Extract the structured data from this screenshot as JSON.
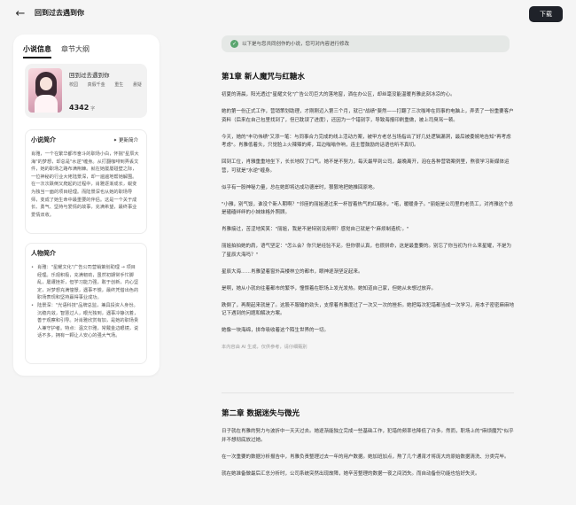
{
  "header": {
    "title": "回到过去遇到你"
  },
  "download_label": "下载",
  "tabs": [
    "小说信息",
    "章节大纲"
  ],
  "novel": {
    "name": "回到过去遇到你",
    "tags": [
      "校园",
      "真假千金",
      "重生",
      "悬疑"
    ],
    "word_count": "4342",
    "word_unit": "字"
  },
  "synopsis": {
    "title": "小说简介",
    "update_label": "更新简介",
    "text": "肖雅，一个在繁华都市奋斗的职场小白，怀揣\"星辰大海\"的梦想，却总是\"水逆\"缠身。从打翻咖啡到弄丢文件，她的职场之路布满荆棘。就在她屡屡碰壁之际，一位神秘的行业大佬陆景深，却一遍遍地帮她解围。在一次次跌倒又爬起的过程中，肖雅逐渐成长，蜕变为独当一面的项目经理。而陆景深也从她的职场导师，变成了她生命中最重要的伴侣。这是一个关于成长、勇气、坚持与爱情的故事，充满希望，最终事业爱情双收。"
  },
  "characters": {
    "title": "人物简介",
    "items": [
      "肖雅：\"星耀文化\"广告公司营销策划助理 → 项目经理。乐观积极，充满韧劲，虽然初期常手忙脚乱，屡遭挫折，但学习能力强，敢于创新，内心坚定，对梦想充满憧憬，遇事不慌，最终凭借出色的职场表现和坚持赢得事业成功。",
      "陆景深：\"光语科技\"品牌总监，兼具投资人身份。沉稳内敛，智慧过人，眼光独到，遇事冷静沉着，善于观察和引导。对肖雅欣赏有加，是她的职场贵人兼守护者。特点：温文尔雅，常戴金边眼镜，说话不多，拥有一颗让人安心的强大气场。"
    ]
  },
  "notice": "以下是与您共同创作的小说，您可对内容进行修改",
  "chapters": [
    {
      "title": "第1章 新人魔咒与红糖水",
      "paragraphs": [
        "初夏的清晨，阳光透过\"星耀文化\"广告公司巨大的落地窗，洒在办公区，却丝毫没能温暖肖雅此刻冰凉的心。",
        "她的第一份正式工作，营销策划助理，才刚刚迈入第三个月，就已\"战绩\"斐然——打翻了三次咖啡在同事的电脑上，弄丢了一份重要客户资料（后来在自己包里找到了，但已耽误了进度），还因为一个错别字，导致海报印刷重做，被上司臭骂一顿。",
        "今天，她的\"丰功伟绩\"又添一笔：与同事合力完成的线上活动方案，被甲方老总当场指出了好几处逻辑漏洞，最后被委婉地告知\"再考虑考虑\"。肖雅低着头，只觉脸上火辣辣的疼，耳边嗡嗡作响，连主管鼓励的话语也听不真切。",
        "回到工位，肖雅重重地坐下，长长地叹了口气。她不是不努力，每天最早到公司，最晚离开，泡在各种营销案例里，熬夜学习新媒体运营，可就是\"水逆\"缠身。",
        "似乎有一股神秘力量，总在她即将达成功德岸时，狠狠地把她推回原地。",
        "\"小雅，别气馁，谁没个新人期啊？\"邻座的丽姐递过来一杯冒着热气的红糖水，\"喏，暖暖身子。\"丽姐是公司里的老员工，对肖雅这个总是磕磕绊绊的小妹妹格外照顾。",
        "肖雅接过，苦涩地笑笑：\"丽姐，我是不是特别没用啊？感觉自己就是个'麻烦制造机'。\"",
        "丽姐拍拍她的肩，语气坚定：\"怎么会？你只是经验不足。但你很认真，也很拼命，这是最重要的。别忘了你当初为什么来星耀，不是为了星辰大海吗？\"",
        "星辰大海……肖雅望着窗外高楼林立的都市，眼神逐渐坚定起来。",
        "是啊，她从小就向往着都市的繁华，憧憬着在职场上发光发热。她知道自己家，但她从未想过放弃。",
        "跌倒了，再爬起来就是了。这股不服输的劲头，支撑着肖雅度过了一次又一次的挫折。她把每次犯错都当成一次学习，用本子密密麻麻地记下遇到的问题和解决方案。",
        "她像一块海绵，拼命吸收着这个陌生世界的一切。"
      ],
      "ai_note": "本内容由 AI 生成，仅供参考，请仔细甄别"
    },
    {
      "title": "第二章 数据迷失与微光",
      "paragraphs": [
        "日子就在肖雅的努力与波折中一天天过去。她逐渐能独立完成一些基础工作，犯错的频率也降低了许多。然而，职场上的\"麻烦魔咒\"似乎并不想彻底放过她。",
        "在一次重要的数据分析报告中，肖雅负责整理过去一年的用户数据。她加班加点，熬了几个通宵才将庞大的原始数据清洗、分类完毕。",
        "就在她准备做最后汇总分析时，公司系统突然出现故障，她辛苦整理的数据一夜之间消失。而自动备份功能也恰好失灵。"
      ]
    }
  ]
}
